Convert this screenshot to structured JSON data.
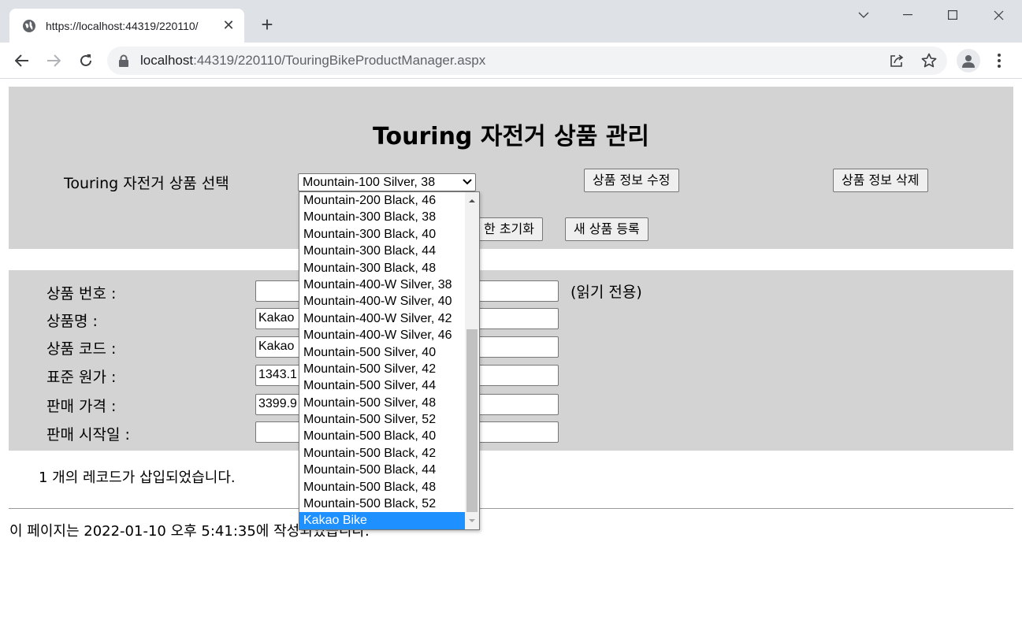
{
  "browser": {
    "tab_title": "https://localhost:44319/220110/",
    "url_host": "localhost",
    "url_rest": ":44319/220110/TouringBikeProductManager.aspx"
  },
  "page": {
    "title": "Touring 자전거 상품 관리",
    "select_label": "Touring 자전거 상품 선택",
    "selected_product": "Mountain-100 Silver, 38",
    "buttons": {
      "update": "상품 정보 수정",
      "delete": "상품 정보 삭제",
      "reset": "한 초기화",
      "register": "새 상품 등록"
    },
    "fields": {
      "product_id_label": "상품 번호 :",
      "product_id_value": "",
      "readonly_note": "(읽기 전용)",
      "name_label": "상품명 :",
      "name_value": "Kakao",
      "code_label": "상품 코드 :",
      "code_value": "Kakao",
      "cost_label": "표준 원가 :",
      "cost_value": "1343.1",
      "price_label": "판매 가격 :",
      "price_value": "3399.9",
      "start_label": "판매 시작일 :",
      "start_value": ""
    },
    "status_message": "1 개의 레코드가 삽입되었습니다.",
    "footer_message": "이 페이지는 2022-01-10 오후 5:41:35에 작성되었습니다."
  },
  "dropdown": {
    "options": [
      "Mountain-200 Black, 46",
      "Mountain-300 Black, 38",
      "Mountain-300 Black, 40",
      "Mountain-300 Black, 44",
      "Mountain-300 Black, 48",
      "Mountain-400-W Silver, 38",
      "Mountain-400-W Silver, 40",
      "Mountain-400-W Silver, 42",
      "Mountain-400-W Silver, 46",
      "Mountain-500 Silver, 40",
      "Mountain-500 Silver, 42",
      "Mountain-500 Silver, 44",
      "Mountain-500 Silver, 48",
      "Mountain-500 Silver, 52",
      "Mountain-500 Black, 40",
      "Mountain-500 Black, 42",
      "Mountain-500 Black, 44",
      "Mountain-500 Black, 48",
      "Mountain-500 Black, 52",
      "Kakao Bike"
    ],
    "highlighted": "Kakao Bike",
    "highlight_color": "#1e90ff"
  },
  "icons": {
    "tab": "globe-icon",
    "tab_close": "close-icon",
    "new_tab": "plus-icon",
    "back": "back-arrow-icon",
    "forward": "forward-arrow-icon",
    "reload": "reload-icon",
    "lock": "lock-icon",
    "share": "share-icon",
    "bookmark": "star-icon",
    "profile": "profile-icon",
    "menu": "kebab-menu-icon"
  },
  "colors": {
    "panel_bg": "#d3d3d3",
    "chrome_bg": "#dee1e6",
    "omnibox_bg": "#f1f3f4"
  }
}
